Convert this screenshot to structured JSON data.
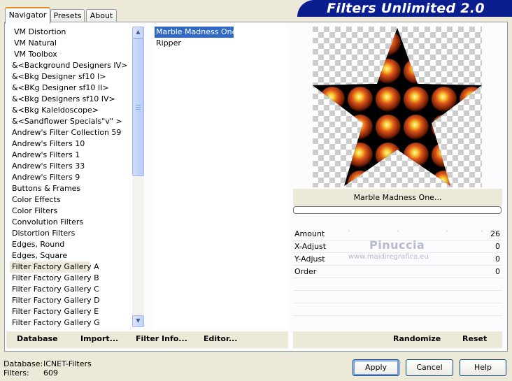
{
  "tabs": [
    "Navigator",
    "Presets",
    "About"
  ],
  "banner": "Filters Unlimited 2.0",
  "categories": [
    "VM Distortion",
    "VM Natural",
    "VM Toolbox",
    "&<Background Designers IV>",
    "&<Bkg Designer sf10 I>",
    "&<BKg Designer sf10 II>",
    "&<Bkg Designers sf10 IV>",
    "&<Bkg Kaleidoscope>",
    "&<Sandflower Specials\"v\" >",
    "Andrew's Filter Collection 59",
    "Andrew's Filters 10",
    "Andrew's Filters 1",
    "Andrew's Filters 33",
    "Andrew's Filters 9",
    "Buttons & Frames",
    "Color Effects",
    "Color Filters",
    "Convolution Filters",
    "Distortion Filters",
    "Edges, Round",
    "Edges, Square",
    "Filter Factory Gallery A",
    "Filter Factory Gallery B",
    "Filter Factory Gallery C",
    "Filter Factory Gallery D",
    "Filter Factory Gallery E",
    "Filter Factory Gallery G"
  ],
  "selected_category": "Filter Factory Gallery A",
  "filters": [
    "Marble Madness One...",
    "Ripper"
  ],
  "selected_filter": "Marble Madness One...",
  "preview_filter_name": "Marble Madness One...",
  "parameters": [
    {
      "label": "Amount",
      "value": "26"
    },
    {
      "label": "X-Adjust",
      "value": "0"
    },
    {
      "label": "Y-Adjust",
      "value": "0"
    },
    {
      "label": "Order",
      "value": "0"
    }
  ],
  "watermark": {
    "name": "Pinuccia",
    "site": "www.maidiregrafica.eu"
  },
  "bottom_left_buttons": [
    "Database",
    "Import...",
    "Filter Info...",
    "Editor..."
  ],
  "bottom_right_buttons": [
    "Randomize",
    "Reset"
  ],
  "status": {
    "database_label": "Database:",
    "database_value": "ICNET-Filters",
    "filters_label": "Filters:",
    "filters_value": "609"
  },
  "dialog_buttons": {
    "apply": "Apply",
    "cancel": "Cancel",
    "help": "Help"
  },
  "colors": {
    "banner": "#0a1e90",
    "selection": "#316ac5",
    "tab_accent": "#e68b2c",
    "marble_orange": "#e0561a",
    "marble_yellow": "#f5e030"
  }
}
